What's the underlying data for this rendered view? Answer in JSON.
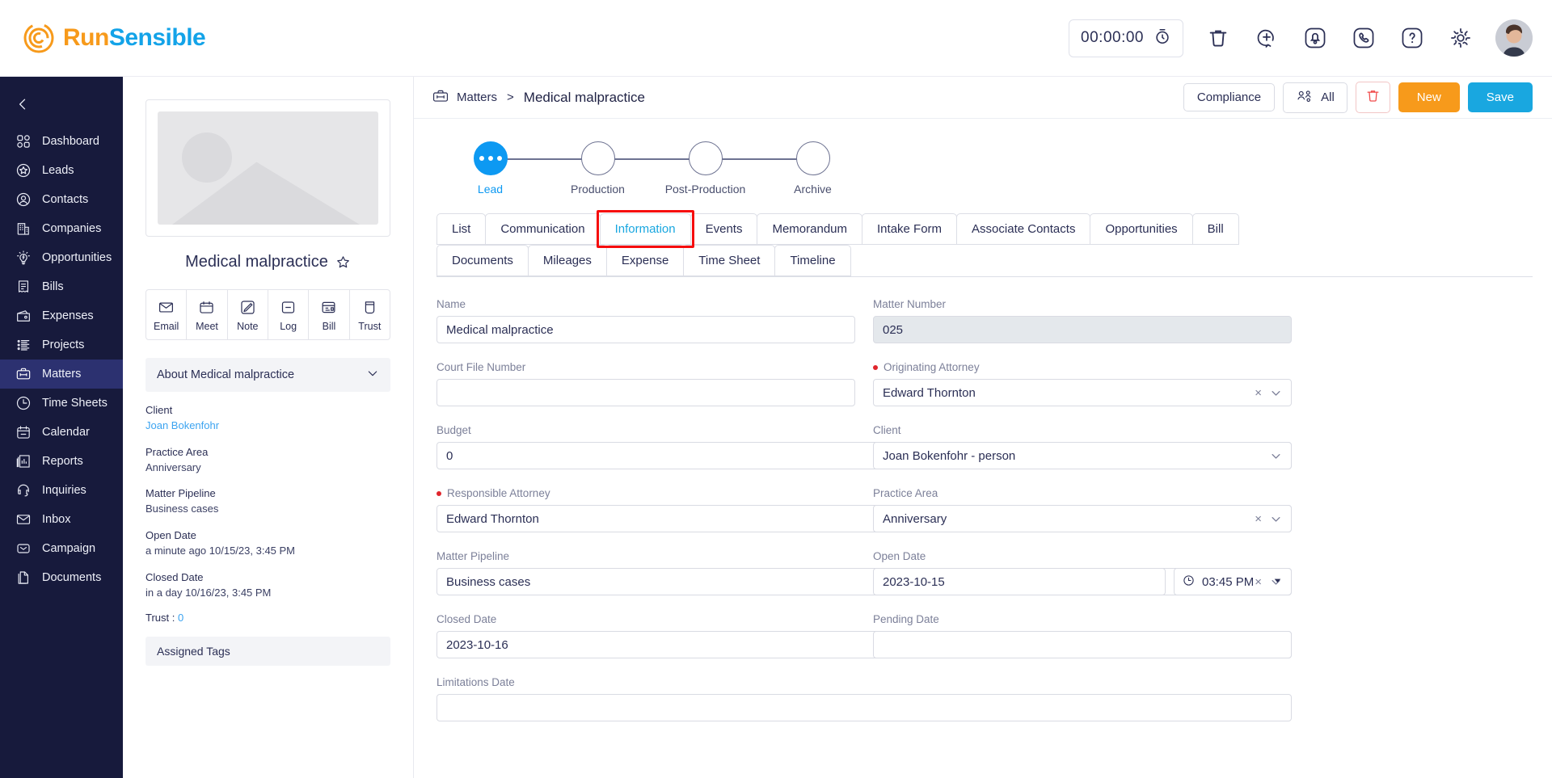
{
  "brand": {
    "run": "Run",
    "sensible": "Sensible",
    "logo_orange": "#f79a1b",
    "logo_blue": "#13a3e8"
  },
  "topbar": {
    "timer_value": "00:00:00",
    "icons": [
      {
        "name": "stopwatch-icon"
      },
      {
        "name": "trash-icon"
      },
      {
        "name": "add-circle-icon"
      },
      {
        "name": "bell-icon"
      },
      {
        "name": "phone-icon"
      },
      {
        "name": "help-icon"
      },
      {
        "name": "gear-icon"
      },
      {
        "name": "avatar"
      }
    ]
  },
  "sidebar": {
    "collapse_label": "collapse",
    "items": [
      {
        "label": "Dashboard",
        "icon": "grid-icon",
        "active": false
      },
      {
        "label": "Leads",
        "icon": "star-circle-icon",
        "active": false
      },
      {
        "label": "Contacts",
        "icon": "person-circle-icon",
        "active": false
      },
      {
        "label": "Companies",
        "icon": "building-icon",
        "active": false
      },
      {
        "label": "Opportunities",
        "icon": "bulb-icon",
        "active": false
      },
      {
        "label": "Bills",
        "icon": "receipt-icon",
        "active": false
      },
      {
        "label": "Expenses",
        "icon": "wallet-icon",
        "active": false
      },
      {
        "label": "Projects",
        "icon": "list-icon",
        "active": false
      },
      {
        "label": "Matters",
        "icon": "briefcase-icon",
        "active": true
      },
      {
        "label": "Time Sheets",
        "icon": "clock-icon",
        "active": false
      },
      {
        "label": "Calendar",
        "icon": "calendar-icon",
        "active": false
      },
      {
        "label": "Reports",
        "icon": "report-icon",
        "active": false
      },
      {
        "label": "Inquiries",
        "icon": "headset-icon",
        "active": false
      },
      {
        "label": "Inbox",
        "icon": "envelope-icon",
        "active": false
      },
      {
        "label": "Campaign",
        "icon": "campaign-icon",
        "active": false
      },
      {
        "label": "Documents",
        "icon": "documents-icon",
        "active": false
      }
    ]
  },
  "breadcrumb": {
    "root": "Matters",
    "separator": ">",
    "current": "Medical malpractice"
  },
  "actions": {
    "compliance": "Compliance",
    "all": "All",
    "delete_icon": "trash-icon",
    "new": "New",
    "save": "Save",
    "new_color": "#f79a1b",
    "save_color": "#19a7e0"
  },
  "leftpanel": {
    "matter_title": "Medical malpractice",
    "favorite_icon": "star-icon",
    "quick_actions": [
      {
        "label": "Email",
        "icon": "email-icon"
      },
      {
        "label": "Meet",
        "icon": "calendar-icon"
      },
      {
        "label": "Note",
        "icon": "note-icon"
      },
      {
        "label": "Log",
        "icon": "log-icon"
      },
      {
        "label": "Bill",
        "icon": "bill-icon"
      },
      {
        "label": "Trust",
        "icon": "trust-icon"
      }
    ],
    "about_title": "About Medical malpractice",
    "details": [
      {
        "key": "Client",
        "value": "Joan Bokenfohr",
        "link": true
      },
      {
        "key": "Practice Area",
        "value": "Anniversary",
        "link": false
      },
      {
        "key": "Matter Pipeline",
        "value": "Business cases",
        "link": false
      },
      {
        "key": "Open Date",
        "value": "a minute ago 10/15/23, 3:45 PM",
        "link": false
      },
      {
        "key": "Closed Date",
        "value": "in a day 10/16/23, 3:45 PM",
        "link": false
      }
    ],
    "trust_label": "Trust :",
    "trust_value": "0",
    "assigned_tags": "Assigned Tags"
  },
  "pipeline": {
    "steps": [
      {
        "label": "Lead",
        "active": true
      },
      {
        "label": "Production",
        "active": false
      },
      {
        "label": "Post-Production",
        "active": false
      },
      {
        "label": "Archive",
        "active": false
      }
    ]
  },
  "tabs": {
    "row1": [
      {
        "label": "List",
        "active": false
      },
      {
        "label": "Communication",
        "active": false
      },
      {
        "label": "Information",
        "active": true,
        "highlight": true
      },
      {
        "label": "Events",
        "active": false
      },
      {
        "label": "Memorandum",
        "active": false
      },
      {
        "label": "Intake Form",
        "active": false
      },
      {
        "label": "Associate Contacts",
        "active": false
      },
      {
        "label": "Opportunities",
        "active": false
      },
      {
        "label": "Bill",
        "active": false
      }
    ],
    "row2": [
      {
        "label": "Documents",
        "active": false
      },
      {
        "label": "Mileages",
        "active": false
      },
      {
        "label": "Expense",
        "active": false
      },
      {
        "label": "Time Sheet",
        "active": false
      },
      {
        "label": "Timeline",
        "active": false
      }
    ],
    "highlight_color": "#f60d0d"
  },
  "form": {
    "name": {
      "label": "Name",
      "value": "Medical malpractice",
      "required": false
    },
    "matter_number": {
      "label": "Matter Number",
      "value": "025",
      "disabled": true,
      "required": false
    },
    "court_file_number": {
      "label": "Court File Number",
      "value": "",
      "required": false
    },
    "originating_attorney": {
      "label": "Originating Attorney",
      "value": "Edward Thornton",
      "required": true,
      "clearable": true
    },
    "budget": {
      "label": "Budget",
      "value": "0",
      "required": false
    },
    "client": {
      "label": "Client",
      "value": "Joan Bokenfohr - person",
      "required": false
    },
    "responsible_attorney": {
      "label": "Responsible Attorney",
      "value": "Edward Thornton",
      "required": true,
      "clearable": true
    },
    "practice_area": {
      "label": "Practice Area",
      "value": "Anniversary",
      "required": false,
      "clearable": true
    },
    "matter_pipeline": {
      "label": "Matter Pipeline",
      "value": "Business cases",
      "required": false,
      "clearable": true
    },
    "open_date": {
      "label": "Open Date",
      "value": "2023-10-15",
      "time": "03:45 PM"
    },
    "closed_date": {
      "label": "Closed Date",
      "value": "2023-10-16",
      "time": "03:45 PM"
    },
    "pending_date": {
      "label": "Pending Date",
      "value": ""
    },
    "limitations_date": {
      "label": "Limitations Date",
      "value": ""
    },
    "clear_glyph": "×"
  }
}
